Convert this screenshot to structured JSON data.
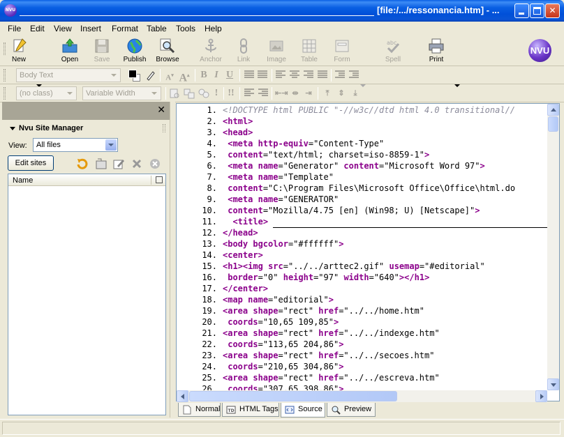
{
  "window": {
    "title": "[file:/.../ressonancia.htm] - ..."
  },
  "menu": [
    "File",
    "Edit",
    "View",
    "Insert",
    "Format",
    "Table",
    "Tools",
    "Help"
  ],
  "toolbar": {
    "new": "New",
    "open": "Open",
    "save": "Save",
    "publish": "Publish",
    "browse": "Browse",
    "anchor": "Anchor",
    "link": "Link",
    "image": "Image",
    "table": "Table",
    "form": "Form",
    "spell": "Spell",
    "print": "Print",
    "logo": "NVU"
  },
  "format_toolbar": {
    "paragraph_style": "Body Text",
    "class": "(no class)",
    "font": "Variable Width",
    "bold": "B",
    "italic": "I",
    "underline": "U",
    "important_1": "!",
    "important_2": "!!"
  },
  "site_manager": {
    "title": "Nvu Site Manager",
    "view_label": "View:",
    "view_value": "All files",
    "edit_sites": "Edit sites",
    "column_name": "Name"
  },
  "source_lines": [
    {
      "n": "1.",
      "t": "<!DOCTYPE html PUBLIC \"-//w3c//dtd html 4.0 transitional//"
    },
    {
      "n": "2.",
      "t": "<html>"
    },
    {
      "n": "3.",
      "t": "<head>"
    },
    {
      "n": "4.",
      "t": " <meta http-equiv=\"Content-Type\""
    },
    {
      "n": "5.",
      "t": " content=\"text/html; charset=iso-8859-1\">"
    },
    {
      "n": "6.",
      "t": " <meta name=\"Generator\" content=\"Microsoft Word 97\">"
    },
    {
      "n": "7.",
      "t": " <meta name=\"Template\""
    },
    {
      "n": "8.",
      "t": " content=\"C:\\Program Files\\Microsoft Office\\Office\\html.do"
    },
    {
      "n": "9.",
      "t": " <meta name=\"GENERATOR\""
    },
    {
      "n": "10.",
      "t": " content=\"Mozilla/4.75 [en] (Win98; U) [Netscape]\">"
    },
    {
      "n": "11.",
      "t": "  <title>"
    },
    {
      "n": "12.",
      "t": "</head>"
    },
    {
      "n": "13.",
      "t": "<body bgcolor=\"#ffffff\">"
    },
    {
      "n": "14.",
      "t": "<center>"
    },
    {
      "n": "15.",
      "t": "<h1><img src=\"../../arttec2.gif\" usemap=\"#editorial\""
    },
    {
      "n": "16.",
      "t": " border=\"0\" height=\"97\" width=\"640\"></h1>"
    },
    {
      "n": "17.",
      "t": "</center>"
    },
    {
      "n": "18.",
      "t": "<map name=\"editorial\">"
    },
    {
      "n": "19.",
      "t": "<area shape=\"rect\" href=\"../../home.htm\""
    },
    {
      "n": "20.",
      "t": " coords=\"10,65 109,85\">"
    },
    {
      "n": "21.",
      "t": "<area shape=\"rect\" href=\"../../indexge.htm\""
    },
    {
      "n": "22.",
      "t": " coords=\"113,65 204,86\">"
    },
    {
      "n": "23.",
      "t": "<area shape=\"rect\" href=\"../../secoes.htm\""
    },
    {
      "n": "24.",
      "t": " coords=\"210,65 304,86\">"
    },
    {
      "n": "25.",
      "t": "<area shape=\"rect\" href=\"../../escreva.htm\""
    },
    {
      "n": "26.",
      "t": " coords=\"307,65 398,86\">"
    }
  ],
  "mode_tabs": [
    "Normal",
    "HTML Tags",
    "Source",
    "Preview"
  ],
  "active_tab": "Source",
  "colors": {
    "titlebar": "#0a5fe3",
    "tag": "#8b008b",
    "doctype": "#8b8b9b",
    "chrome": "#ece9d8"
  }
}
